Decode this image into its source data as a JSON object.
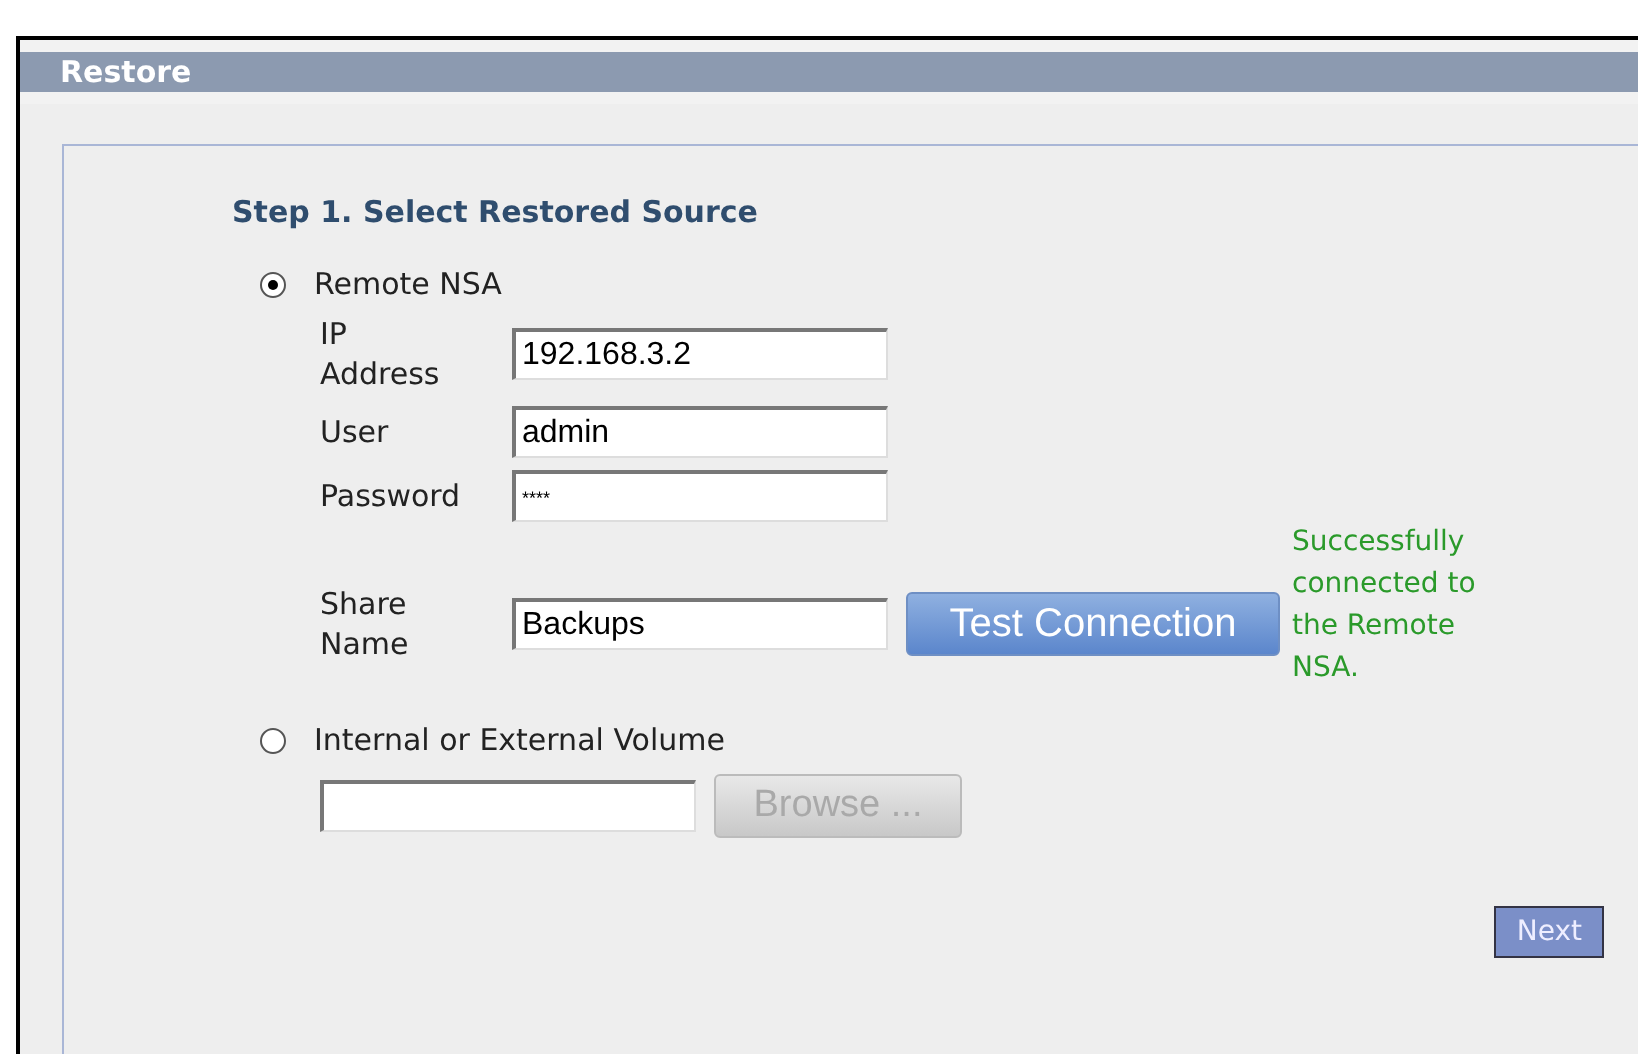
{
  "panel": {
    "title": "Restore"
  },
  "step_title": "Step 1. Select Restored Source",
  "sources": [
    {
      "label": "Remote NSA",
      "selected": true
    },
    {
      "label": "Internal or External Volume",
      "selected": false
    }
  ],
  "remote_fields": [
    {
      "label": "IP Address",
      "value": "192.168.3.2"
    },
    {
      "label": "User",
      "value": "admin"
    },
    {
      "label": "Password",
      "value": "****"
    },
    {
      "label": "Share Name",
      "value": "Backups"
    }
  ],
  "test_button": "Test Connection",
  "test_message": "Successfully connected to the Remote NSA.",
  "browse_button": {
    "label": "Browse ...",
    "disabled": true
  },
  "next_button": "Next"
}
